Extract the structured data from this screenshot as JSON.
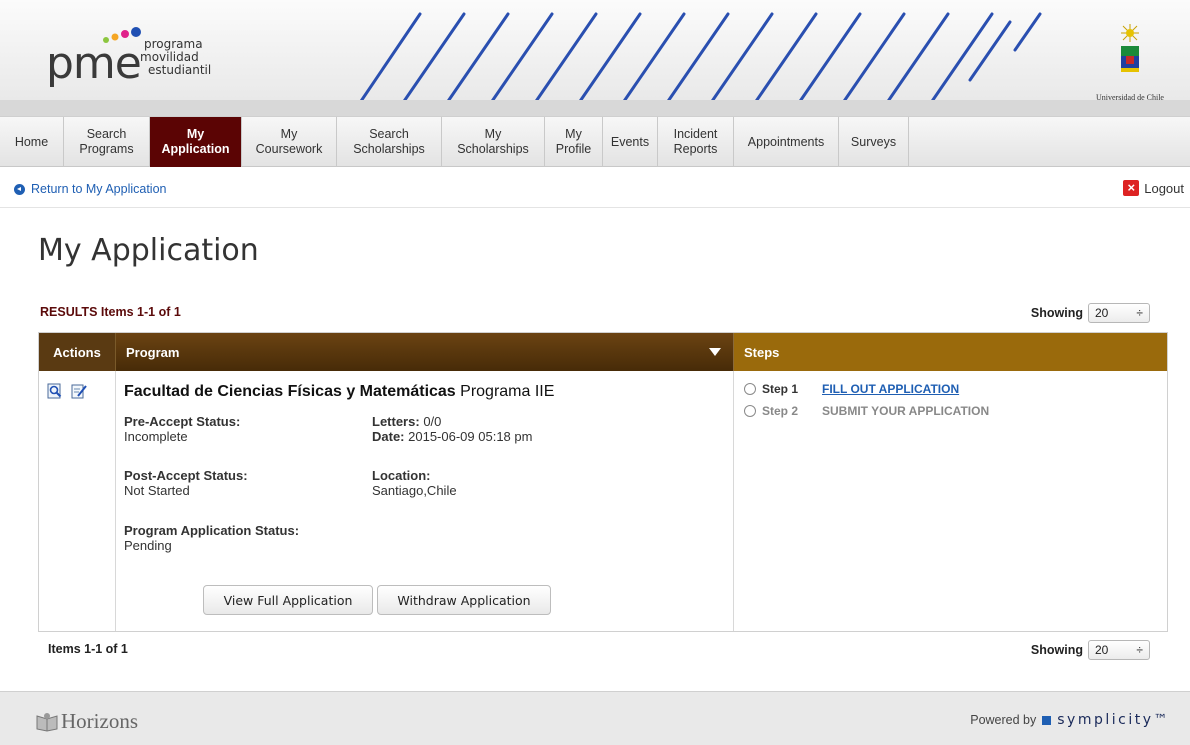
{
  "brand": {
    "logo_main": "pme",
    "logo_words": [
      "programa",
      "movilidad",
      "estudiantil"
    ],
    "university": "Universidad de Chile",
    "accent_color": "#5b0404",
    "stripe_color": "#2a4fb0"
  },
  "nav": {
    "items": [
      {
        "lines": [
          "Home"
        ]
      },
      {
        "lines": [
          "Search",
          "Programs"
        ]
      },
      {
        "lines": [
          "My",
          "Application"
        ],
        "active": true
      },
      {
        "lines": [
          "My",
          "Coursework"
        ]
      },
      {
        "lines": [
          "Search",
          "Scholarships"
        ]
      },
      {
        "lines": [
          "My",
          "Scholarships"
        ]
      },
      {
        "lines": [
          "My",
          "Profile"
        ]
      },
      {
        "lines": [
          "Events"
        ]
      },
      {
        "lines": [
          "Incident",
          "Reports"
        ]
      },
      {
        "lines": [
          "Appointments"
        ]
      },
      {
        "lines": [
          "Surveys"
        ]
      }
    ]
  },
  "subbar": {
    "return_label": "Return to My Application",
    "logout_label": "Logout"
  },
  "page": {
    "title": "My Application"
  },
  "results": {
    "label_prefix": "RESULTS",
    "label_items": "Items 1-1 of 1",
    "showing_label": "Showing",
    "showing_value": "20",
    "bottom_items": "Items 1-1 of 1"
  },
  "table": {
    "headers": {
      "actions": "Actions",
      "program": "Program",
      "steps": "Steps"
    },
    "row": {
      "program_bold": "Facultad de Ciencias Físicas y Matemáticas",
      "program_rest": " Programa IIE",
      "pre_accept_label": "Pre-Accept Status:",
      "pre_accept_value": "Incomplete",
      "letters_label": "Letters:",
      "letters_value": "0/0",
      "date_label": "Date:",
      "date_value": "2015-06-09 05:18 pm",
      "post_accept_label": "Post-Accept Status:",
      "post_accept_value": "Not Started",
      "location_label": "Location:",
      "location_value": "Santiago,Chile",
      "program_app_status_label": "Program Application Status:",
      "program_app_status_value": "Pending",
      "view_button": "View Full Application",
      "withdraw_button": "Withdraw Application"
    },
    "steps": [
      {
        "num": "Step 1",
        "label": "FILL OUT APPLICATION"
      },
      {
        "num": "Step 2",
        "label": "SUBMIT YOUR APPLICATION"
      }
    ]
  },
  "footer": {
    "horizons": "Horizons",
    "powered_by": "Powered by",
    "symplicity": "symplicity™"
  }
}
